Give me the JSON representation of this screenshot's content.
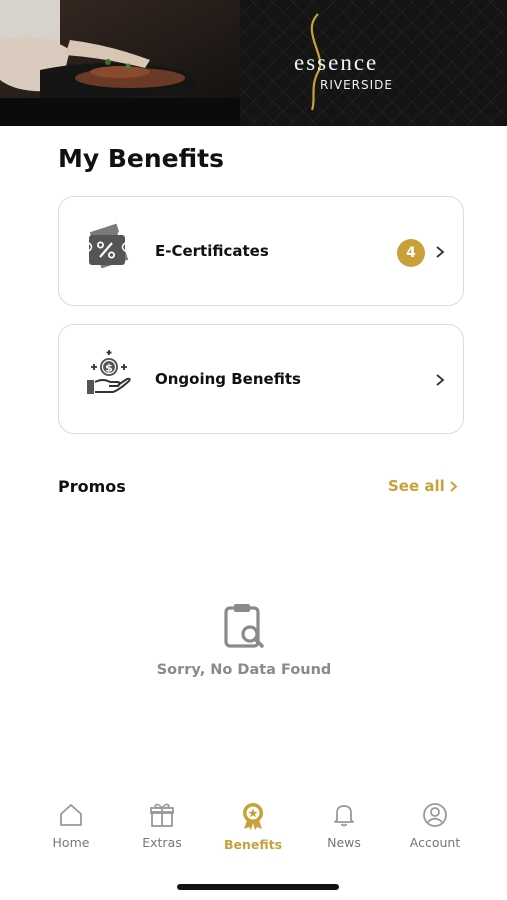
{
  "banner": {
    "brand_main": "essence",
    "brand_sub": "RIVERSIDE"
  },
  "page_title": "My Benefits",
  "cards": [
    {
      "label": "E-Certificates",
      "badge": "4",
      "icon": "e-certificate-ticket-icon"
    },
    {
      "label": "Ongoing Benefits",
      "icon": "hand-coin-icon"
    }
  ],
  "promos": {
    "title": "Promos",
    "see_all": "See all",
    "empty_text": "Sorry, No Data Found",
    "empty_icon": "clipboard-search-icon"
  },
  "tabs": [
    {
      "label": "Home",
      "icon": "home-icon"
    },
    {
      "label": "Extras",
      "icon": "gift-icon"
    },
    {
      "label": "Benefits",
      "icon": "benefits-badge-icon",
      "active": true
    },
    {
      "label": "News",
      "icon": "bell-icon"
    },
    {
      "label": "Account",
      "icon": "account-icon"
    }
  ],
  "colors": {
    "accent": "#c9a13b",
    "banner_bg": "#141414",
    "text": "#111111",
    "muted": "#8a8a8a"
  }
}
